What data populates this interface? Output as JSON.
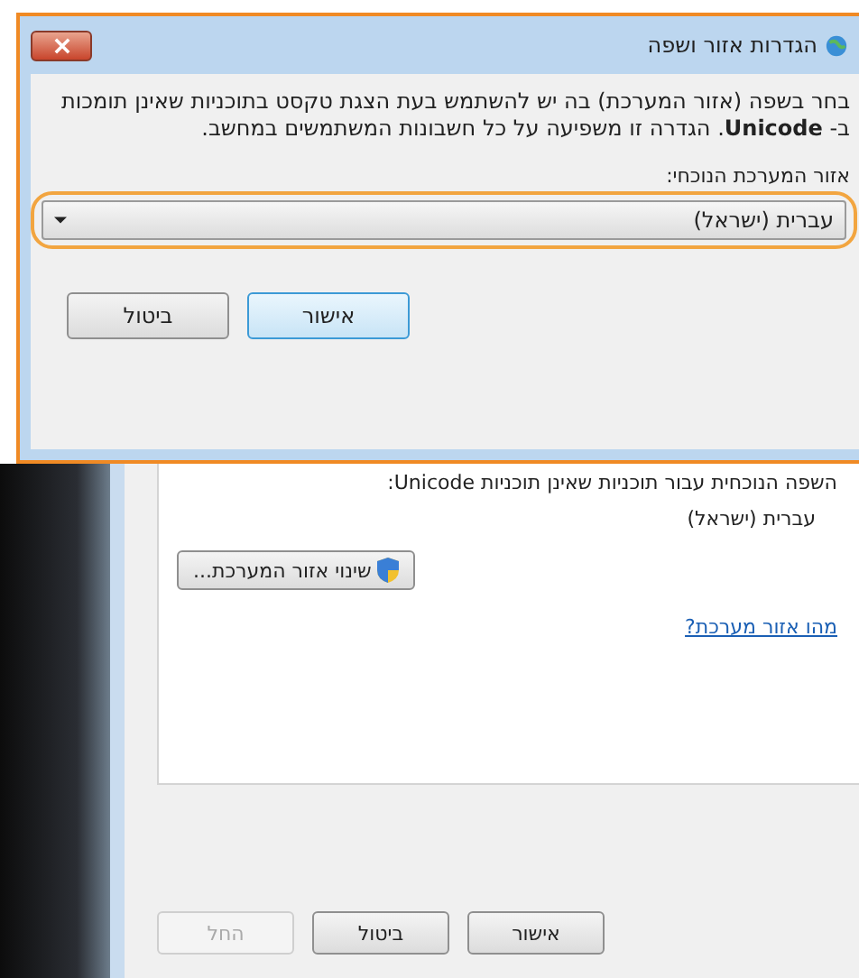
{
  "dialog": {
    "title": "הגדרות אזור ושפה",
    "description": "בחר בשפה (אזור המערכת) בה יש להשתמש בעת הצגת טקסט בתוכניות שאינן תומכות ב- **Unicode**. הגדרה זו משפיעה על כל חשבונות המשתמשים במחשב.",
    "field_label": "אזור המערכת הנוכחי:",
    "select": {
      "value": "עברית (ישראל)",
      "highlighted": true
    },
    "buttons": [
      {
        "label": "אישור",
        "default": true
      },
      {
        "label": "ביטול",
        "default": false
      }
    ]
  },
  "background_window": {
    "panel": {
      "heading": "השפה הנוכחית עבור תוכניות שאינן תוכניות Unicode:",
      "current_language": "עברית (ישראל)",
      "change_button": "שינוי אזור המערכת...",
      "link": "מהו אזור מערכת?"
    },
    "buttons": [
      {
        "label": "אישור",
        "disabled": false
      },
      {
        "label": "ביטול",
        "disabled": false
      },
      {
        "label": "החל",
        "disabled": true
      }
    ]
  }
}
